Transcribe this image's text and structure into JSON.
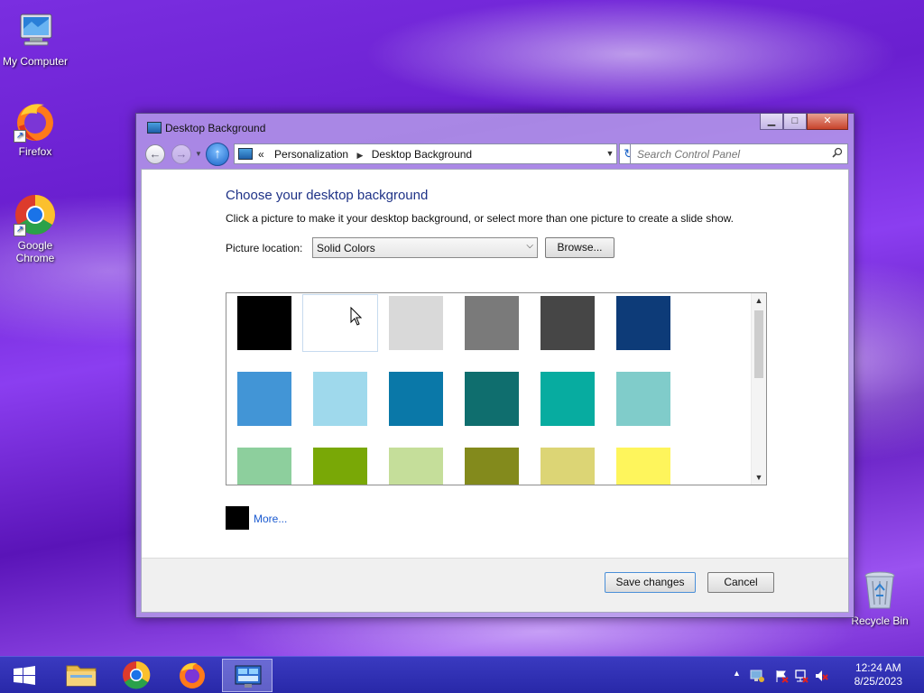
{
  "desktop": {
    "icons": [
      {
        "label": "My Computer"
      },
      {
        "label": "Firefox"
      },
      {
        "label": "Google Chrome"
      },
      {
        "label": "Recycle Bin"
      }
    ]
  },
  "window": {
    "title": "Desktop Background",
    "controls": {
      "minimize": "▁",
      "maximize": "□",
      "close": "✕"
    },
    "breadcrumb": {
      "prefix": "«",
      "items": [
        "Personalization",
        "Desktop Background"
      ]
    },
    "search_placeholder": "Search Control Panel",
    "heading": "Choose your desktop background",
    "description": "Click a picture to make it your desktop background, or select more than one picture to create a slide show.",
    "picture_location_label": "Picture location:",
    "picture_location_value": "Solid Colors",
    "browse_label": "Browse...",
    "more_label": "More...",
    "save_label": "Save changes",
    "cancel_label": "Cancel"
  },
  "gallery": {
    "selected_index": 1,
    "swatches": [
      "#000000",
      "#ffffff",
      "#d9d9d9",
      "#7a7a7a",
      "#464646",
      "#0d3b78",
      "#4295d6",
      "#9fd9ec",
      "#0a78a8",
      "#0f6e6e",
      "#07aca0",
      "#80ccca",
      "#8dcf9d",
      "#79a806",
      "#c5de9a",
      "#838a1c",
      "#dcd575",
      "#fef55c"
    ]
  },
  "more_swatch_color": "#000000",
  "taskbar": {
    "items": [
      "start-button",
      "file-explorer",
      "google-chrome",
      "firefox",
      "control-panel"
    ],
    "active_item": "control-panel",
    "clock_time": "12:24 AM",
    "clock_date": "8/25/2023"
  }
}
